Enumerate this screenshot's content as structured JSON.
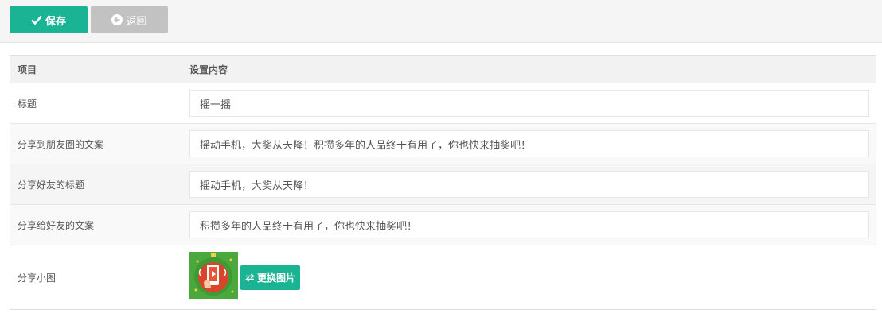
{
  "toolbar": {
    "save_label": "保存",
    "back_label": "返回"
  },
  "table": {
    "headers": [
      "项目",
      "设置内容"
    ],
    "rows": [
      {
        "label": "标题",
        "value": "摇一摇"
      },
      {
        "label": "分享到朋友圈的文案",
        "value": "摇动手机，大奖从天降！积攒多年的人品终于有用了，你也快来抽奖吧！"
      },
      {
        "label": "分享好友的标题",
        "value": "摇动手机，大奖从天降！"
      },
      {
        "label": "分享给好友的文案",
        "value": "积攒多年的人品终于有用了，你也快来抽奖吧！"
      },
      {
        "label": "分享小图"
      }
    ],
    "change_image_label": "更换图片"
  },
  "colors": {
    "primary": "#1ab394",
    "secondary": "#c2c2c2"
  }
}
